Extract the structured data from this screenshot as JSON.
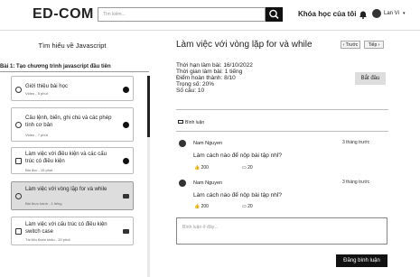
{
  "header": {
    "logo": "ED-COM",
    "search_placeholder": "Tìm kiếm...",
    "course_link": "Khóa học của tôi",
    "user_name": "Lan Vi"
  },
  "sidebar": {
    "title": "Tìm hiểu về Javascript",
    "lesson_heading": "Bài 1: Tạo chương trình javascript đầu tiên",
    "items": [
      {
        "title": "Giới thiệu bài học",
        "meta": "Video - 5 phút",
        "status": "done"
      },
      {
        "title": "Câu lệnh, biến, ghi chú và các phép tính cơ bản",
        "meta": "Video - 7 phút",
        "status": "done"
      },
      {
        "title": "Làm việc với điều kiện và các cấu trúc có điều kiện",
        "meta": "Bài đọc - 15 phút",
        "status": "done"
      },
      {
        "title": "Làm việc với vòng lặp for và while",
        "meta": "Bài thực hành - 1 tiếng",
        "status": "locked"
      },
      {
        "title": "Làm việc với cấu trúc có điều kiện switch case",
        "meta": "Tài liệu tham khảo - 20 phút",
        "status": "locked"
      }
    ]
  },
  "main": {
    "title": "Làm việc với vòng lặp for và while",
    "prev_label": "Trước",
    "next_label": "Tiếp",
    "info": [
      "Thời hạn làm bài: 16/10/2022",
      "Thời gian làm bài: 1 tiếng",
      "Điểm hoàn thành: 8/10",
      "Trọng số: 20%",
      "Số câu: 10"
    ],
    "start_label": "Bắt đầu",
    "comments_tab": "Bình luận",
    "comments": [
      {
        "name": "Nam Nguyen",
        "time": "3 tháng trước",
        "text": "Làm cách nào để nộp bài tập nhỉ?",
        "likes": "200",
        "replies": "20"
      },
      {
        "name": "Nam Nguyen",
        "time": "3 tháng trước",
        "text": "Làm cách nào để nộp bài tập nhỉ?",
        "likes": "200",
        "replies": "20"
      }
    ],
    "comment_placeholder": "Bình luận ở đây...",
    "post_label": "Đăng bình luận"
  }
}
